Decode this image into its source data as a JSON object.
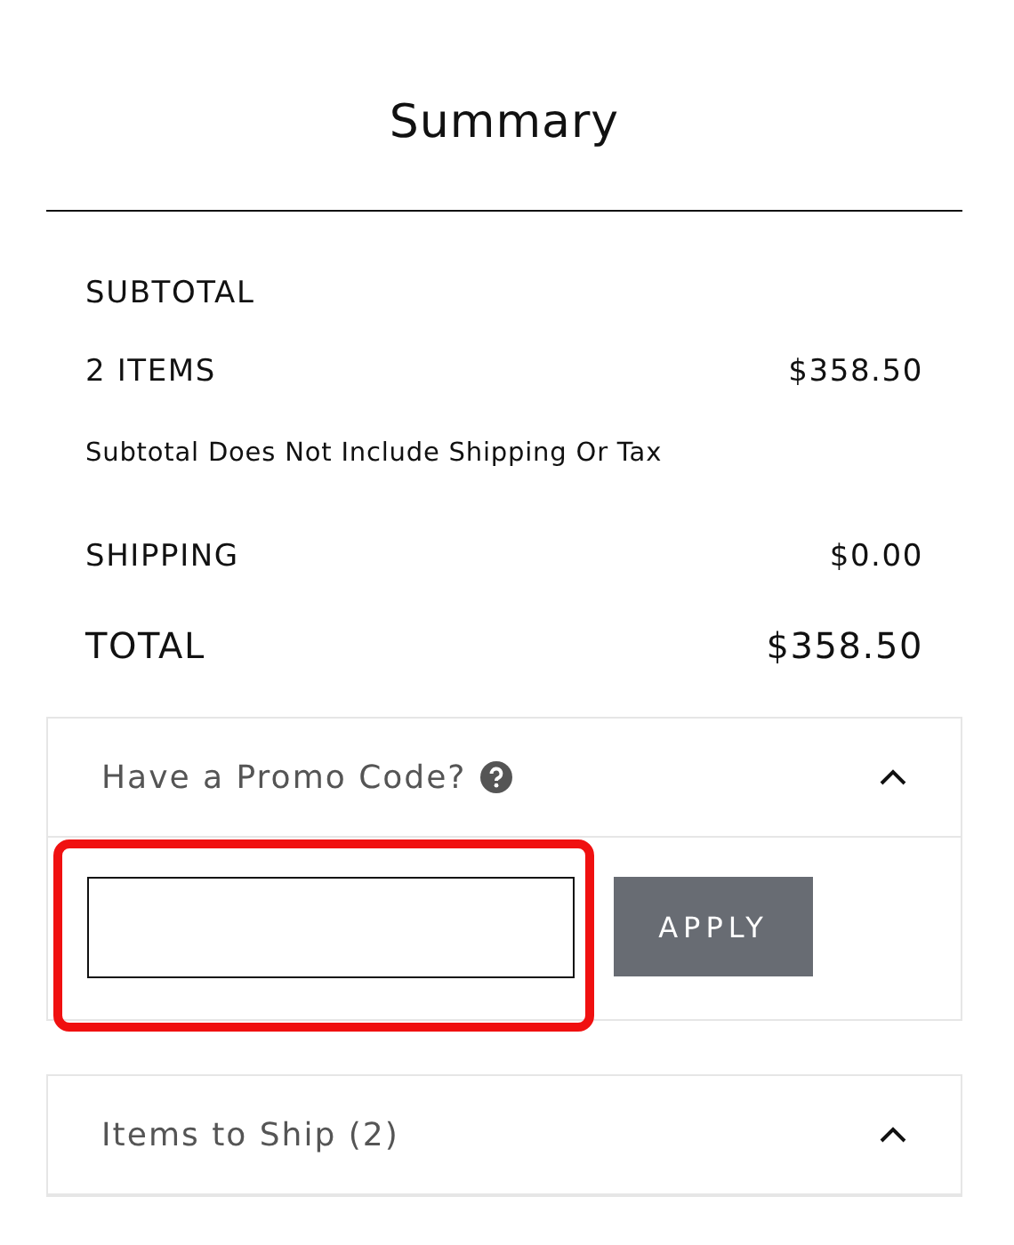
{
  "title": "Summary",
  "subtotal_heading": "SUBTOTAL",
  "lines": [
    {
      "kind": "item",
      "label": "2 ITEMS",
      "amount": "$358.50"
    },
    {
      "kind": "note",
      "label": "Subtotal Does Not Include Shipping Or Tax"
    },
    {
      "kind": "item",
      "label": "SHIPPING",
      "amount": "$0.00"
    },
    {
      "kind": "total",
      "label": "TOTAL",
      "amount": "$358.50"
    }
  ],
  "panels": [
    {
      "title": "Have a Promo Code?",
      "help": true,
      "expanded": true,
      "kind": "promo",
      "button": "APPLY",
      "highlighted": true
    },
    {
      "title": "Items to Ship (2)",
      "help": false,
      "expanded": true,
      "kind": "list"
    }
  ]
}
